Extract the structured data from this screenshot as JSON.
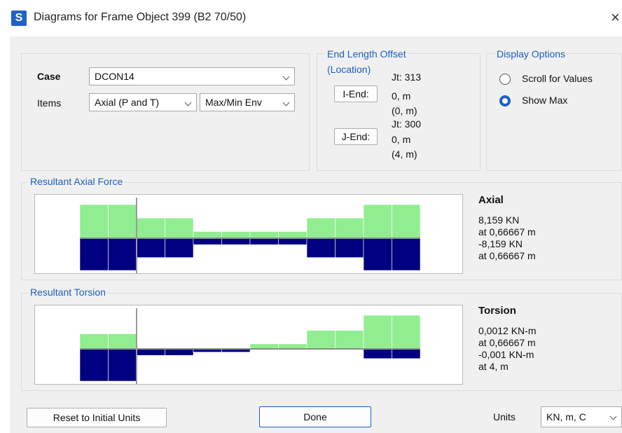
{
  "window": {
    "title": "Diagrams for Frame Object 399  (B2 70/50)",
    "app_icon_letter": "S",
    "close_glyph": "×"
  },
  "case": {
    "label": "Case",
    "value": "DCON14"
  },
  "items": {
    "label": "Items",
    "component": "Axial (P and T)",
    "envelope": "Max/Min Env"
  },
  "end_length_offset": {
    "title_line1": "End Length Offset",
    "title_line2": "(Location)",
    "i_end": {
      "button": "I-End:",
      "joint": "Jt:  313",
      "offset": "0, m",
      "location": "(0, m)"
    },
    "j_end": {
      "button": "J-End:",
      "joint": "Jt:  300",
      "offset": "0, m",
      "location": "(4, m)"
    }
  },
  "display_options": {
    "title": "Display Options",
    "options": [
      {
        "label": "Scroll for Values",
        "selected": false
      },
      {
        "label": "Show Max",
        "selected": true
      }
    ]
  },
  "axial": {
    "group_title": "Resultant Axial Force",
    "heading": "Axial",
    "max_value": "8,159 KN",
    "max_at": "at 0,66667 m",
    "min_value": "-8,159 KN",
    "min_at": "at 0,66667 m"
  },
  "torsion": {
    "group_title": "Resultant Torsion",
    "heading": "Torsion",
    "max_value": "0,0012 KN-m",
    "max_at": "at 0,66667 m",
    "min_value": "-0,001 KN-m",
    "min_at": "at 4, m"
  },
  "footer": {
    "reset_button": "Reset to Initial Units",
    "done_button": "Done",
    "units_label": "Units",
    "units_value": "KN, m, C"
  },
  "colors": {
    "positive_fill": "#90ee90",
    "negative_fill": "#000080",
    "group_title": "#1d5fb8",
    "accent": "#1a5fc8"
  },
  "diagrams": {
    "axial": {
      "positive": [
        1.0,
        1.0,
        0.6,
        0.6,
        0.2,
        0.2,
        0.2,
        0.2,
        0.6,
        0.6,
        1.0,
        1.0
      ],
      "negative": [
        1.0,
        1.0,
        0.6,
        0.6,
        0.2,
        0.2,
        0.2,
        0.2,
        0.6,
        0.6,
        1.0,
        1.0
      ]
    },
    "torsion": {
      "positive": [
        0.45,
        0.45,
        0.0,
        0.0,
        0.0,
        0.0,
        0.15,
        0.15,
        0.55,
        0.55,
        1.0,
        1.0
      ],
      "negative": [
        1.0,
        1.0,
        0.2,
        0.2,
        0.1,
        0.1,
        0.0,
        0.0,
        0.0,
        0.0,
        0.3,
        0.3
      ]
    }
  }
}
